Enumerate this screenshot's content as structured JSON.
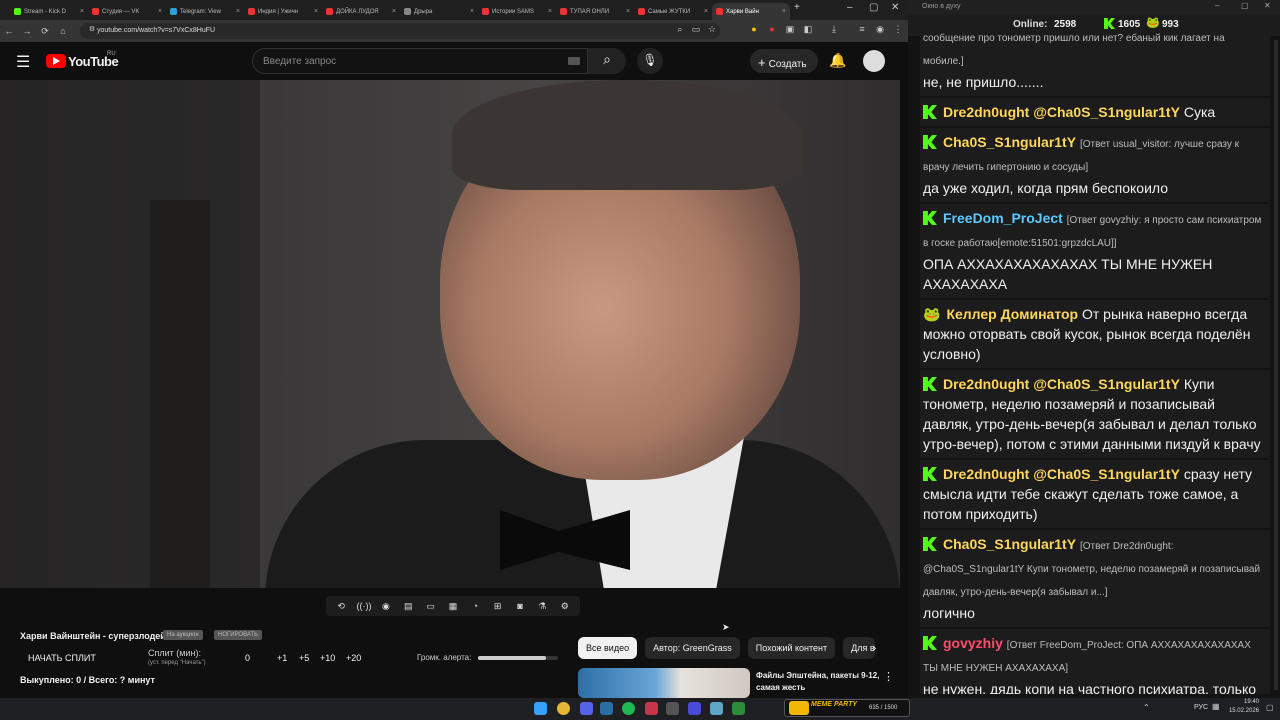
{
  "browser": {
    "tabs": [
      {
        "label": "Stream - Kick D",
        "color": "#53fc18",
        "active": false
      },
      {
        "label": "Студия — VK",
        "color": "#e33",
        "active": false
      },
      {
        "label": "Telegram: View",
        "color": "#2aa3d8",
        "active": false
      },
      {
        "label": "Индия | Ужичн",
        "color": "#e33",
        "active": false
      },
      {
        "label": "ДОЙКА ЛУДОЯ",
        "color": "#e33",
        "active": false
      },
      {
        "label": "Дрыра",
        "color": "#888",
        "active": false
      },
      {
        "label": "Истории SAMS",
        "color": "#e33",
        "active": false
      },
      {
        "label": "ТУПАЯ ОНЛИ",
        "color": "#e33",
        "active": false
      },
      {
        "label": "Самые ЖУТКИ",
        "color": "#e33",
        "active": false
      },
      {
        "label": "Харви Вайн",
        "color": "#e33",
        "active": true
      }
    ],
    "url": "youtube.com/watch?v=s7VxCx8HuFU"
  },
  "youtube": {
    "logo_text": "YouTube",
    "region": "RU",
    "search_placeholder": "Введите запрос",
    "create_label": "Создать"
  },
  "below_video": {
    "title": "Харви Вайнштейн - суперзлодей",
    "badge1": "На аукцион",
    "badge2": "НОГИРОВАТЬ",
    "start_split": "НАЧАТЬ СПЛИТ",
    "split_label": "Сплит (мин):",
    "split_sub": "(уст. перед \"Начать\")",
    "split_value": "0",
    "inc": [
      "+1",
      "+5",
      "+10",
      "+20"
    ],
    "volume_label": "Громк. алерта:",
    "volume_level": 0.85,
    "bought": "Выкуплено: 0 / Всего: ? минут"
  },
  "chips": [
    "Все видео",
    "Автор: GreenGrass",
    "Похожий контент",
    "Для в"
  ],
  "recommended": {
    "title": "Файлы Эпштейна, пакеты 9-12, самая жесть"
  },
  "chat": {
    "window_title": "Окно в духу",
    "online_label": "Online:",
    "online_count": "2598",
    "kick_count": "1605",
    "other_count": "993",
    "messages": [
      {
        "kind": "tail",
        "reply": "сообщение про тонометр пришло или нет? ебаный кик лагает на мобиле.]",
        "text": "не, не пришло......."
      },
      {
        "kind": "kick",
        "user": "Dre2dn0ught",
        "color": "#ffd75e",
        "reply": "",
        "mention": "@Cha0S_S1ngular1tY",
        "text": " Сука"
      },
      {
        "kind": "kick",
        "user": "Cha0S_S1ngular1tY",
        "color": "#ffd75e",
        "reply": "[Ответ usual_visitor: лучше сразу к врачу лечить гипертонию и сосуды]",
        "mention": "",
        "text": "да уже ходил, когда прям беспокоило"
      },
      {
        "kind": "kick",
        "user": "FreeDom_ProJect",
        "color": "#5ec8ff",
        "reply": "[Ответ govyzhiy: я просто сам психиатром в госке работаю[emote:51501:grpzdcLAU]]",
        "mention": "",
        "text": "ОПА АХХАХАХАХАХАХАХ ТЫ МНЕ НУЖЕН АХАХАХАХА"
      },
      {
        "kind": "other",
        "user": "Келлер Доминатор",
        "color": "#ffd75e",
        "reply": "",
        "mention": "",
        "text": " От рынка наверно всегда можно оторвать свой кусок, рынок всегда поделён условно)"
      },
      {
        "kind": "kick",
        "user": "Dre2dn0ught",
        "color": "#ffd75e",
        "reply": "",
        "mention": "@Cha0S_S1ngular1tY",
        "text": " Купи тонометр, неделю позамеряй и позаписывай давляк, утро-день-вечер(я забывал и делал только утро-вечер), потом с этими данными пиздуй к врачу"
      },
      {
        "kind": "kick",
        "user": "Dre2dn0ught",
        "color": "#ffd75e",
        "reply": "",
        "mention": "@Cha0S_S1ngular1tY",
        "text": " сразу нету смысла идти тебе скажут сделать тоже самое, а потом приходить)"
      },
      {
        "kind": "kick",
        "user": "Cha0S_S1ngular1tY",
        "color": "#ffd75e",
        "reply": "[Ответ Dre2dn0ught: @Cha0S_S1ngular1tY Купи тонометр, неделю позамеряй и позаписывай давляк, утро-день-вечер(я забывал и...]",
        "mention": "",
        "text": "логично"
      },
      {
        "kind": "kick",
        "user": "govyzhiy",
        "color": "#ff4d6d",
        "reply": "[Ответ FreeDom_ProJect: ОПА АХХАХАХАХАХАХАХ ТЫ МНЕ НУЖЕН АХАХАХАХА]",
        "mention": "",
        "text": "не нужен, дядь    копи на частного психиатра, только найди норм клинику, а не залупу"
      }
    ]
  },
  "taskbar": {
    "overlay_label": "MEME PARTY",
    "overlay_counter": "635 / 1500",
    "lang": "РУС",
    "time": "19:40",
    "date": "15.02.2026"
  }
}
